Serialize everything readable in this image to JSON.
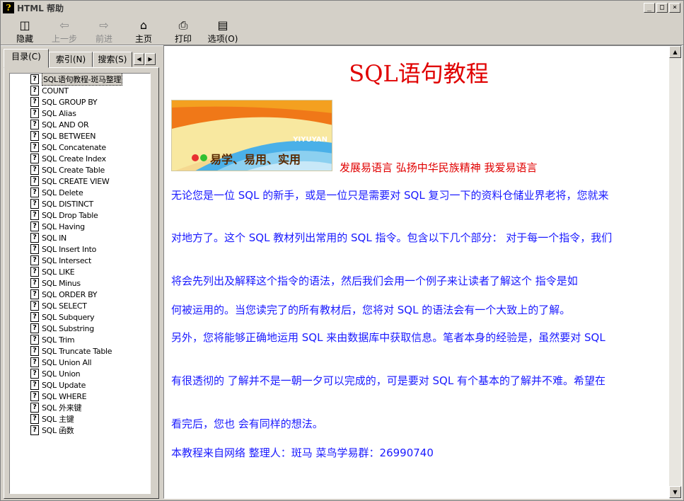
{
  "window": {
    "title": "HTML 帮助",
    "icon_name": "help-question-icon",
    "buttons": [
      "_",
      "□",
      "×"
    ]
  },
  "toolbar": {
    "items": [
      {
        "label": "隐藏",
        "icon": "hide-pane-icon",
        "enabled": true
      },
      {
        "label": "上一步",
        "icon": "back-arrow-icon",
        "enabled": false
      },
      {
        "label": "前进",
        "icon": "forward-arrow-icon",
        "enabled": false
      },
      {
        "label": "主页",
        "icon": "home-icon",
        "enabled": true
      },
      {
        "label": "打印",
        "icon": "printer-icon",
        "enabled": true
      },
      {
        "label": "选项(O)",
        "icon": "options-icon",
        "enabled": true
      }
    ]
  },
  "tabs": [
    {
      "label": "目录(C)",
      "active": true
    },
    {
      "label": "索引(N)",
      "active": false
    },
    {
      "label": "搜索(S)",
      "active": false
    }
  ],
  "tree": {
    "items": [
      "SQL语句教程-斑马整理",
      "COUNT",
      "SQL GROUP BY",
      "SQL Alias",
      "SQL AND OR",
      "SQL BETWEEN",
      "SQL Concatenate",
      "SQL Create Index",
      "SQL Create Table",
      "SQL CREATE VIEW",
      "SQL Delete",
      "SQL DISTINCT",
      "SQL Drop Table",
      "SQL Having",
      "SQL IN",
      "SQL Insert Into",
      "SQL Intersect",
      "SQL LIKE",
      "SQL Minus",
      "SQL ORDER BY",
      "SQL SELECT",
      "SQL Subquery",
      "SQL Substring",
      "SQL Trim",
      "SQL Truncate Table",
      "SQL Union All",
      "SQL Union",
      "SQL Update",
      "SQL WHERE",
      "SQL 外来键",
      "SQL 主键",
      "SQL 函数"
    ],
    "selected_index": 0
  },
  "content": {
    "title": "SQL语句教程",
    "banner_brand": "YIYUYAN",
    "banner_text": "易学、易用、实用",
    "slogan": "发展易语言 弘扬中华民族精神 我爱易语言",
    "paragraphs": [
      "无论您是一位 SQL 的新手，或是一位只是需要对 SQL 复习一下的资料仓储业界老将，您就来",
      "对地方了。这个 SQL 教材列出常用的 SQL 指令。包含以下几个部分： 对于每一个指令，我们",
      "将会先列出及解释这个指令的语法，然后我们会用一个例子来让读者了解这个 指令是如",
      "何被运用的。当您读完了的所有教材后，您将对 SQL 的语法会有一个大致上的了解。",
      "另外，您将能够正确地运用 SQL 来由数据库中获取信息。笔者本身的经验是，虽然要对 SQL",
      "有很透彻的 了解并不是一朝一夕可以完成的，可是要对 SQL 有个基本的了解并不难。希望在",
      "看完后，您也 会有同样的想法。",
      "本教程来自网络 整理人：斑马 菜鸟学易群：26990740"
    ],
    "title_color": "#e00000",
    "text_color": "#1a1aff"
  }
}
